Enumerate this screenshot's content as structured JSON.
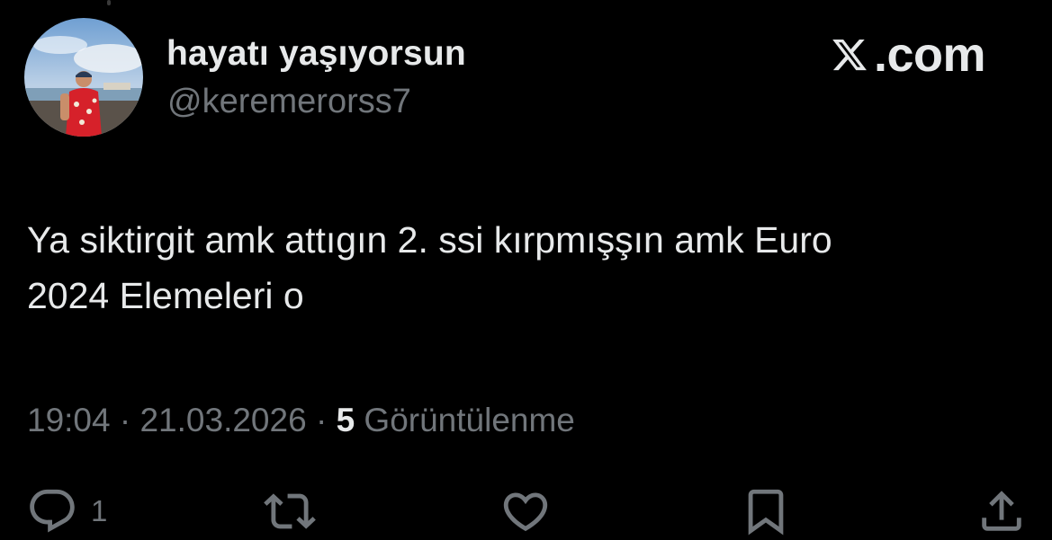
{
  "author": {
    "display_name": "hayatı yaşıyorsun",
    "handle": "@keremerorss7"
  },
  "brand": {
    "text": ".com",
    "logo_icon": "x-logo-icon"
  },
  "tweet": {
    "text": "Ya siktirgit amk attıgın 2. ssi kırpmışşın amk Euro\n2024 Elemeleri o",
    "time": "19:04",
    "separator": "·",
    "date": "21.03.2026",
    "views_count": "5",
    "views_label": "Görüntülenme"
  },
  "actions": {
    "reply": {
      "icon": "reply-icon",
      "count": "1"
    },
    "retweet": {
      "icon": "retweet-icon"
    },
    "like": {
      "icon": "heart-icon"
    },
    "bookmark": {
      "icon": "bookmark-icon"
    },
    "share": {
      "icon": "share-icon"
    }
  },
  "colors": {
    "background": "#000000",
    "primary_text": "#e7e9ea",
    "secondary_text": "#71767b"
  }
}
